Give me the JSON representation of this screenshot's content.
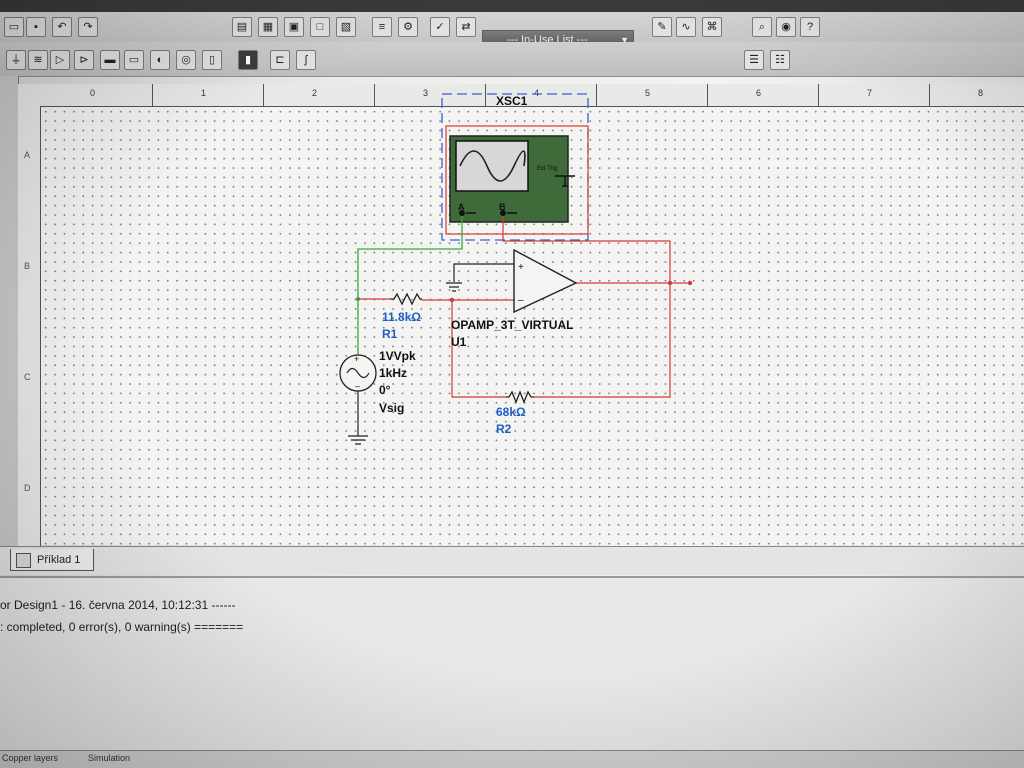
{
  "toolbar": {
    "in_use_list": "--- In-Use List ---"
  },
  "ruler": {
    "columns": [
      "0",
      "1",
      "2",
      "3",
      "4",
      "5",
      "6",
      "7",
      "8"
    ],
    "rows": [
      "A",
      "B",
      "C",
      "D"
    ]
  },
  "schematic": {
    "oscilloscope": {
      "ref": "XSC1",
      "channel_a": "A",
      "channel_b": "B",
      "ext_trig": "Ext Trig"
    },
    "r1": {
      "value": "11.8kΩ",
      "ref": "R1"
    },
    "r2": {
      "value": "68kΩ",
      "ref": "R2"
    },
    "opamp": {
      "model": "OPAMP_3T_VIRTUAL",
      "ref": "U1",
      "plus": "+",
      "minus": "–"
    },
    "source": {
      "amplitude": "1VVpk",
      "frequency": "1kHz",
      "phase": "0°",
      "ref": "Vsig"
    }
  },
  "tab": {
    "label": "Příklad 1"
  },
  "output": {
    "line1": "or Design1 - 16. června 2014, 10:12:31 ------",
    "line2": ": completed, 0 error(s), 0 warning(s) ======="
  },
  "bottom_tabs": [
    "Copper layers",
    "Simulation"
  ],
  "colors": {
    "wire_red": "#d23a3a",
    "wire_green": "#3aa843",
    "label_blue": "#1f5fc4",
    "scope_green": "#3f6a3a",
    "scope_frame_blue": "#3a5fd0"
  }
}
